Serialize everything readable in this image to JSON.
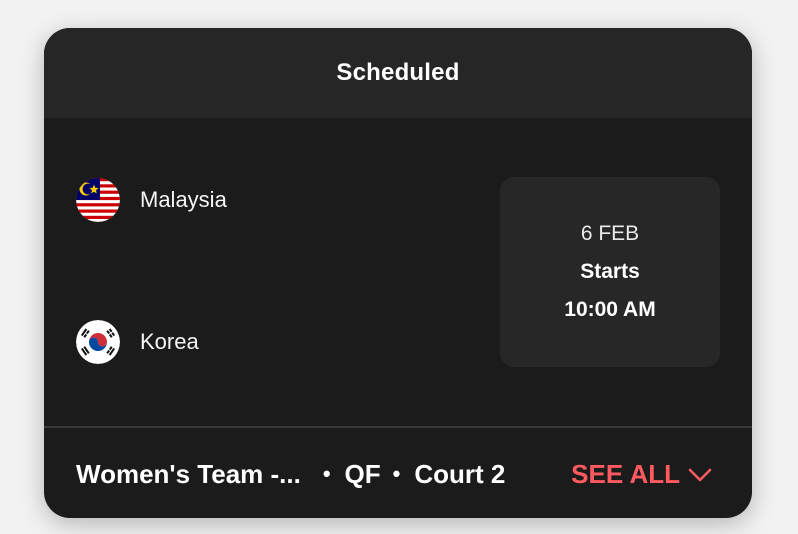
{
  "header": {
    "title": "Scheduled"
  },
  "match": {
    "team1": {
      "name": "Malaysia",
      "flag_icon": "malaysia-flag-icon"
    },
    "team2": {
      "name": "Korea",
      "flag_icon": "korea-flag-icon"
    },
    "date": "6 FEB",
    "starts_label": "Starts",
    "time": "10:00 AM"
  },
  "footer": {
    "event": "Women's Team -...",
    "round": "QF",
    "court": "Court 2",
    "see_all_label": "SEE ALL",
    "see_all_icon": "chevron-down-icon"
  },
  "colors": {
    "accent": "#ff5a5f",
    "card_bg": "#1b1b1b",
    "header_bg": "#262626"
  }
}
